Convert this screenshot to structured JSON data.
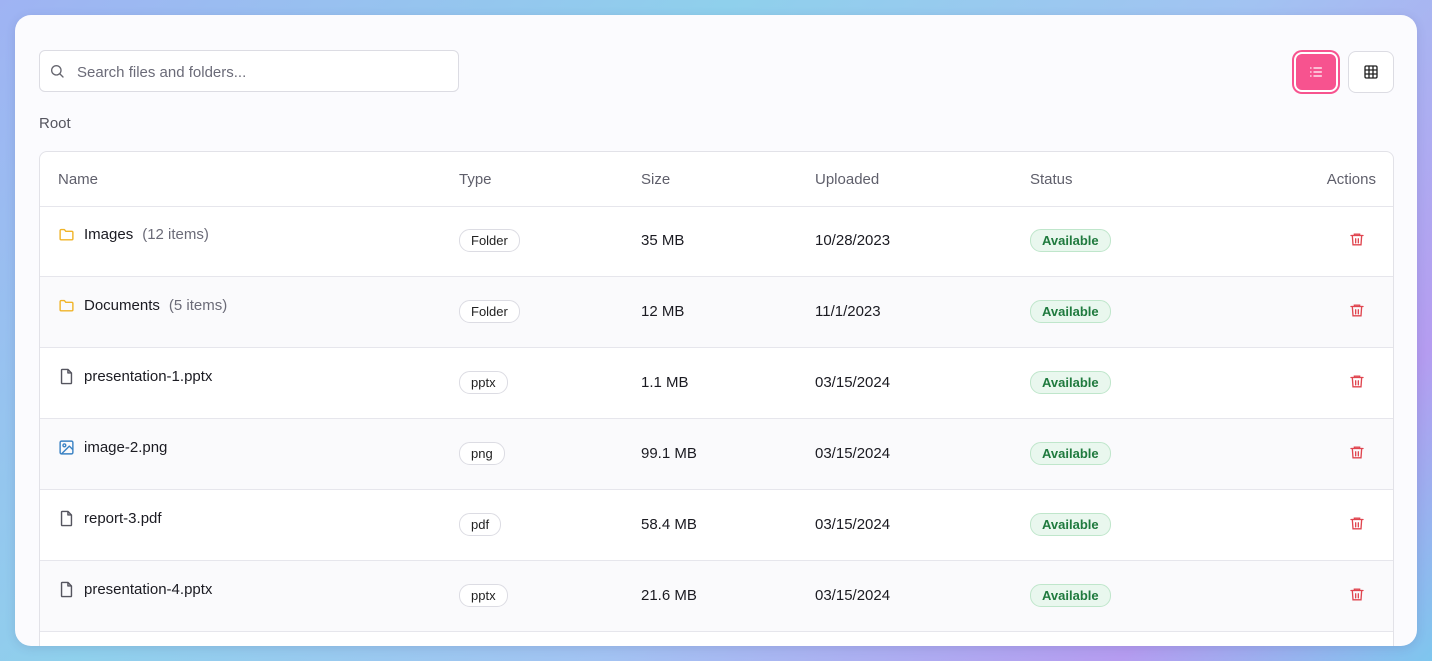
{
  "search": {
    "placeholder": "Search files and folders..."
  },
  "view_toggle": {
    "active": "list",
    "buttons": [
      {
        "icon": "list-icon"
      },
      {
        "icon": "grid-icon"
      }
    ],
    "accent": "#f7538f"
  },
  "breadcrumb": "Root",
  "table": {
    "columns": [
      "Name",
      "Type",
      "Size",
      "Uploaded",
      "Status",
      "Actions"
    ],
    "rows": [
      {
        "icon": "folder-icon",
        "name": "Images",
        "count": "(12 items)",
        "type": "Folder",
        "size": "35 MB",
        "uploaded": "10/28/2023",
        "status": "Available"
      },
      {
        "icon": "folder-icon",
        "name": "Documents",
        "count": "(5 items)",
        "type": "Folder",
        "size": "12 MB",
        "uploaded": "11/1/2023",
        "status": "Available"
      },
      {
        "icon": "file-icon",
        "name": "presentation-1.pptx",
        "count": "",
        "type": "pptx",
        "size": "1.1 MB",
        "uploaded": "03/15/2024",
        "status": "Available"
      },
      {
        "icon": "image-icon",
        "name": "image-2.png",
        "count": "",
        "type": "png",
        "size": "99.1 MB",
        "uploaded": "03/15/2024",
        "status": "Available"
      },
      {
        "icon": "file-icon",
        "name": "report-3.pdf",
        "count": "",
        "type": "pdf",
        "size": "58.4 MB",
        "uploaded": "03/15/2024",
        "status": "Available"
      },
      {
        "icon": "file-icon",
        "name": "presentation-4.pptx",
        "count": "",
        "type": "pptx",
        "size": "21.6 MB",
        "uploaded": "03/15/2024",
        "status": "Available"
      }
    ]
  },
  "colors": {
    "folder": "#f0b429",
    "image": "#3b82c4",
    "file": "#55555f",
    "delete": "#e0454f",
    "status_text": "#1f7a3e"
  }
}
